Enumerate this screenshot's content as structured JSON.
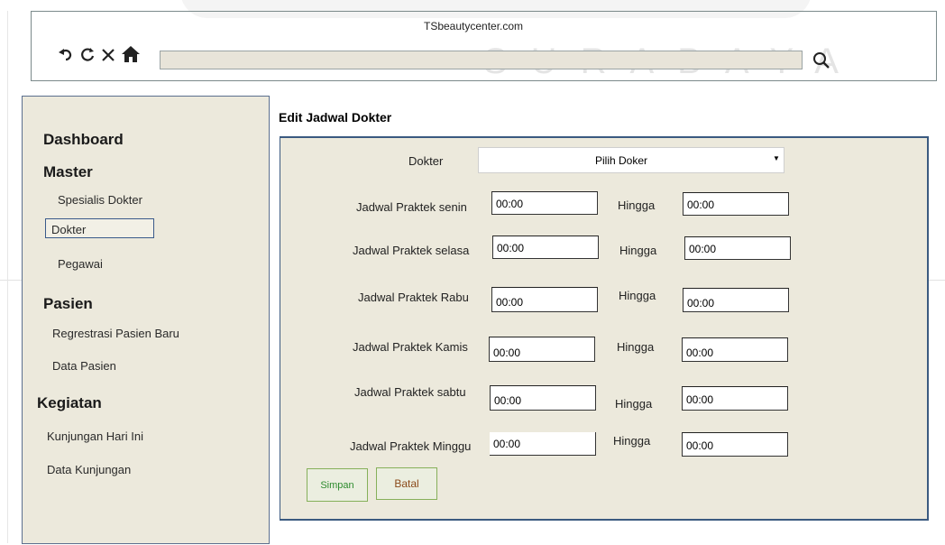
{
  "watermark": {
    "text": "SURABAYA"
  },
  "browser": {
    "url": "TSbeautycenter.com",
    "icons": {
      "back": "back-icon",
      "refresh": "refresh-icon",
      "stop": "stop-icon",
      "home": "home-icon",
      "search": "search-icon"
    },
    "address_value": ""
  },
  "sidebar": {
    "dashboard": "Dashboard",
    "master": "Master",
    "master_items": [
      "Spesialis Dokter",
      "Dokter",
      "Pegawai"
    ],
    "pasien": "Pasien",
    "pasien_items": [
      "Regrestrasi Pasien Baru",
      "Data Pasien"
    ],
    "kegiatan": "Kegiatan",
    "kegiatan_items": [
      "Kunjungan Hari Ini",
      "Data Kunjungan"
    ],
    "selected": "Dokter"
  },
  "main": {
    "title": "Edit Jadwal Dokter",
    "dokter_label": "Dokter",
    "dokter_select": "Pilih Doker",
    "hingga": "Hingga",
    "rows": [
      {
        "label": "Jadwal Praktek senin",
        "from": "00:00",
        "to": "00:00"
      },
      {
        "label": "Jadwal Praktek selasa",
        "from": "00:00",
        "to": "00:00"
      },
      {
        "label": "Jadwal Praktek Rabu",
        "from": "00:00",
        "to": "00:00"
      },
      {
        "label": "Jadwal Praktek Kamis",
        "from": "00:00",
        "to": "00:00"
      },
      {
        "label": "Jadwal Praktek sabtu",
        "from": "00:00",
        "to": "00:00"
      },
      {
        "label": "Jadwal Praktek Minggu",
        "from": "00:00",
        "to": "00:00"
      }
    ],
    "simpan": "Simpan",
    "batal": "Batal"
  },
  "colors": {
    "panel_bg": "#ece9dc",
    "panel_border": "#3b5a80",
    "simpan_text": "#2e8b2e",
    "batal_text": "#8b4a1a"
  }
}
